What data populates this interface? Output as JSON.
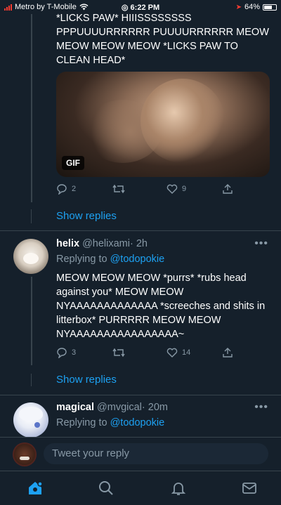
{
  "status_bar": {
    "carrier": "Metro by T-Mobile",
    "time": "6:22 PM",
    "battery": "64%"
  },
  "tweet1": {
    "text": "*LICKS PAW* HIIISSSSSSSS PPPUUUURRRRRR PUUUURRRRRR MEOW MEOW MEOW MEOW *LICKS PAW TO CLEAN HEAD*",
    "gif_badge": "GIF",
    "replies": "2",
    "retweets": "",
    "likes": "9",
    "show_replies": "Show replies"
  },
  "tweet2": {
    "name": "helix",
    "handle": "@helixami",
    "time": "· 2h",
    "replying_prefix": "Replying to",
    "replying_to": "@todopokie",
    "text": "MEOW MEOW MEOW *purrs* *rubs head against you* MEOW MEOW NYAAAAAAAAAAAAA *screeches and shits in litterbox* PURRRRR MEOW MEOW NYAAAAAAAAAAAAAAAA~",
    "replies": "3",
    "retweets": "",
    "likes": "14",
    "show_replies": "Show replies"
  },
  "tweet3": {
    "name": "magical",
    "handle": "@mvgical",
    "time": "· 20m",
    "replying_prefix": "Replying to",
    "replying_to": "@todopokie"
  },
  "composer": {
    "placeholder": "Tweet your reply"
  },
  "colors": {
    "background": "#15202b",
    "accent": "#1da1f2",
    "muted": "#8899a6",
    "divider": "#38444d"
  },
  "icons": [
    "reply-icon",
    "retweet-icon",
    "like-icon",
    "share-icon",
    "more-icon",
    "home-icon",
    "search-icon",
    "notifications-icon",
    "messages-icon"
  ]
}
